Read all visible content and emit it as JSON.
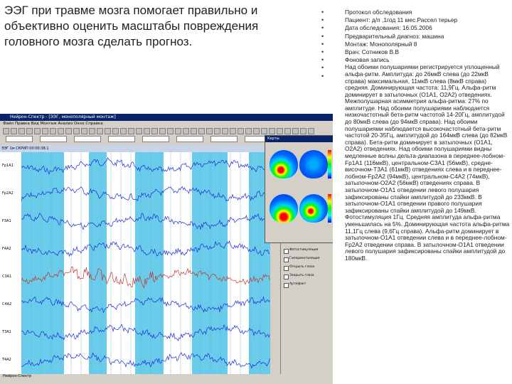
{
  "slide": {
    "title": "ЭЭГ при травме мозга помогает правильно и объективно оценить масштабы повреждения головного мозга сделать прогноз."
  },
  "report_lines": [
    "Протокол обследования",
    "Пациент: д/п ,1год 11 мес.Рассел терьер",
    "Дата обследования: 16.05.2006",
    "Предварительный диагноз: машина",
    "Монтаж: Монополярный 8",
    "Врач: Сотников В.В",
    "Фоновая запись"
  ],
  "report_paragraph": "Над обоими полушариями регистрируется уплощенный альфа-ритм. Амплитуда: до 26мкВ слева (до 22мкВ справа) максимальная, 11мкВ слева (8мкВ справа) средняя. Доминирующая частота: 11,9Гц. Альфа-ритм доминирует в затылочных (O1A1, O2A2) отведениях. Межполушарная асимметрия альфа-ритма: 27% по амплитуде. Над обоими полушариями наблюдается низкочастотный бета-ритм частотой 14-20Гц, амплитудой до 80мкВ слева (до 94мкВ справа). Над обоими полушариями наблюдается высокочастотный бета-ритм частотой 20-35Гц, амплитудой до 164мкВ слева (до 82мкВ справа). Бета-ритм доминирует в затылочных (O1A1, O2A2) отведениях. Над обоими полушариями видны медленные волны дельта-диапазона в переднее-лобном-Fp1A1 (116мкВ), центральном-C3A1 (56мкВ), средне-височном-T3A1 (61мкВ) отведениях слева и в переднее-лобном-Fp2A2 (94мкВ), центральном-C4A2 (74мкВ), затылочном-O2A2 (56мкВ) отведениях справа. В затылочном-O1A1 отведении левого полушария зафиксированы спайки амплитудой до 233мкВ. В затылочном-O1A1 отведении правого полушария зафиксированы спайки амплитудой до 149мкВ. Фотостимуляция 1Гц. Средняя амплитуда альфа-ритма уменьшилась на 5%. Доминирующая частота альфа-ритма 11,1Гц слева (9,6Гц справа). Альфа-ритм доминирует в затылочном-O1A1 отведении слева и в переднее-лобном-Fp2A2 отведении справа. В затылочном-O1A1 отведении левого полушария зафиксированы спайки амплитудой до 180мкВ.",
  "bullet_glyph": "•",
  "eeg": {
    "window_title": "Нейрон-Спектр - [ЭЭГ, монополярный монтаж]",
    "menu": "Файл  Правка  Вид  Монтаж  Анализ  Окно  Справка",
    "header": "ЭЭГ 1м   СКРИП  00:00:38.1",
    "channels": [
      "Fp1A1",
      "Fp2A2",
      "F3A1",
      "F4A2",
      "C3A1",
      "C4A2",
      "T3A1",
      "T4A2"
    ],
    "status": "Нейрон-Спектр",
    "maps_title": "Карты",
    "checkboxes": [
      "Фотостимуляция",
      "Гипервентиляция",
      "Открыть глаза",
      "Закрыть глаза",
      "Артефакт"
    ]
  },
  "colors": {
    "eeg_band": "#4fc3e8",
    "signal": "#1a2bd6",
    "spike": "#c83030"
  }
}
